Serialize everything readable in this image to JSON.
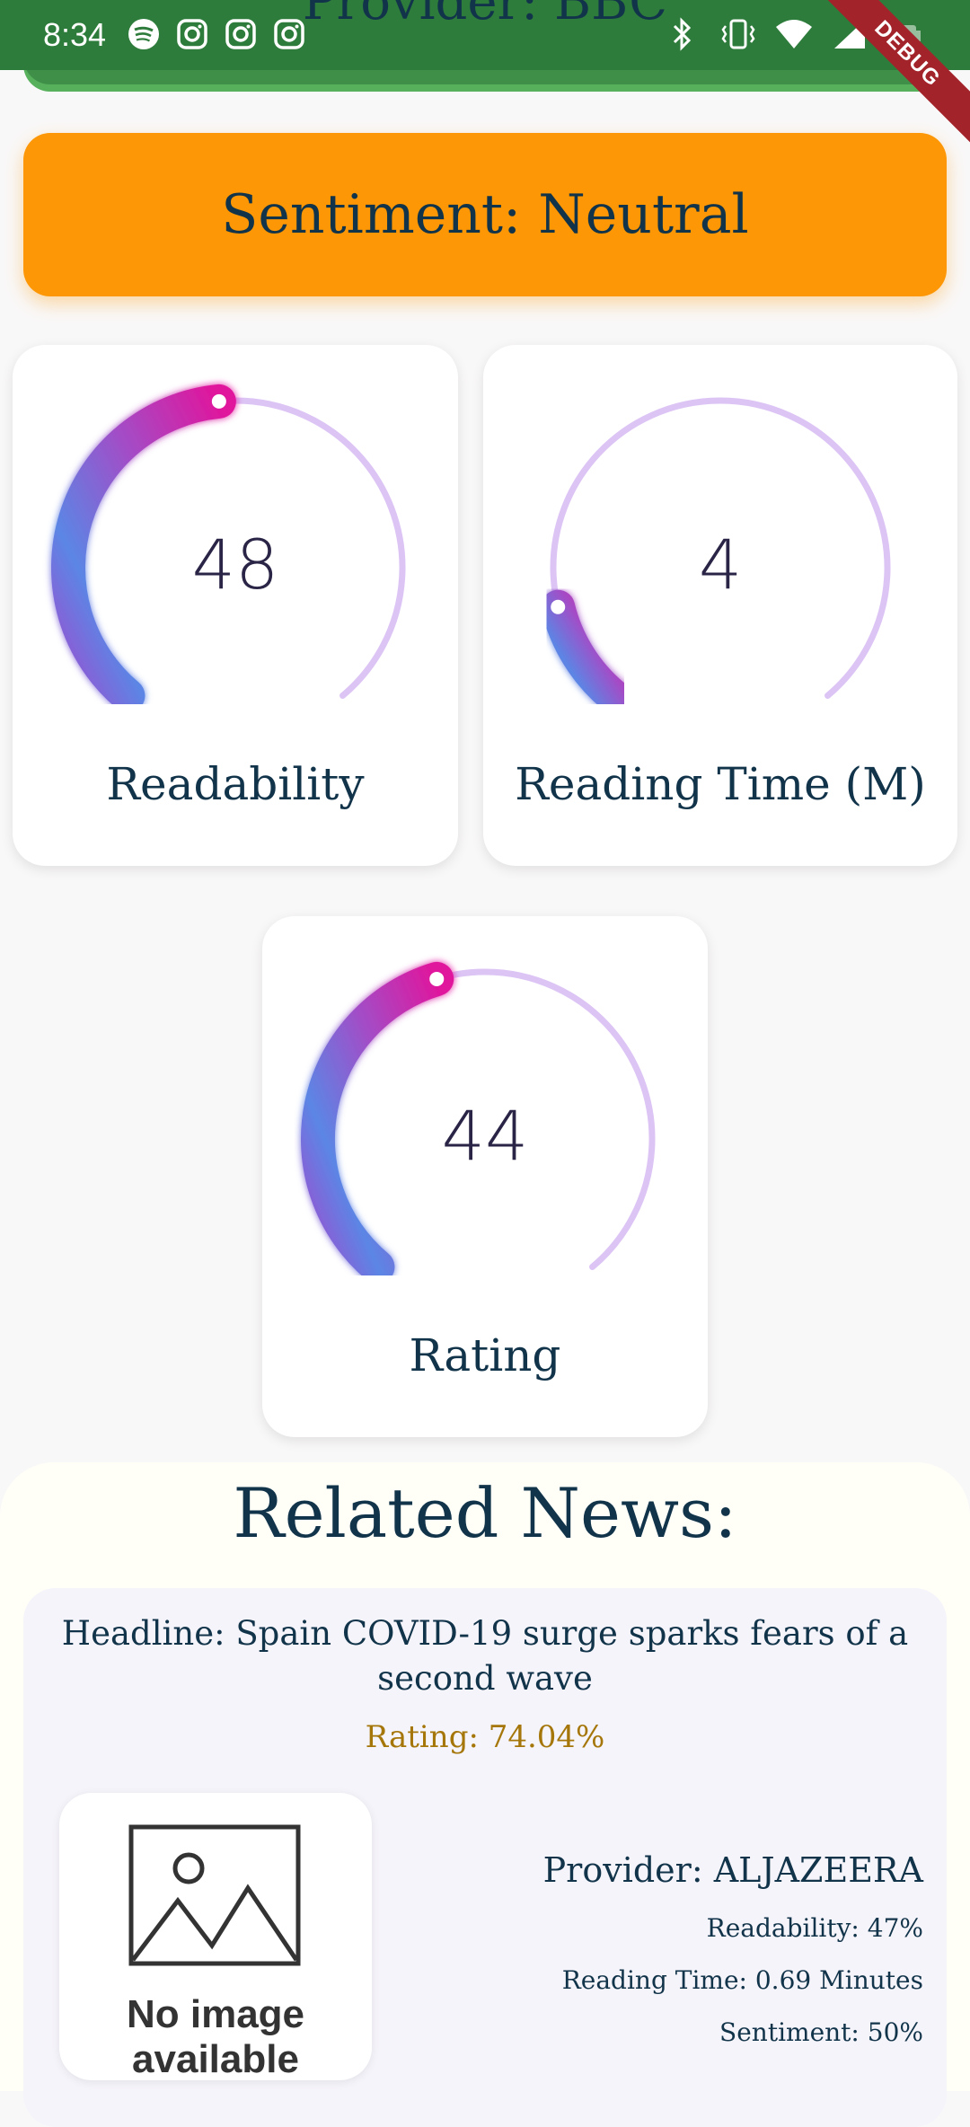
{
  "status_bar": {
    "time": "8:34",
    "left_icons": [
      "spotify-icon",
      "instagram-icon",
      "instagram-icon",
      "instagram-icon"
    ],
    "right_icons": [
      "bluetooth-icon",
      "vibrate-icon",
      "wifi-icon",
      "signal-icon",
      "battery-icon"
    ]
  },
  "debug_label": "DEBUG",
  "header": {
    "provider_text": "Provider: BBC"
  },
  "sentiment": {
    "text": "Sentiment: Neutral",
    "color": "#fd9705"
  },
  "gauges": {
    "readability": {
      "value": "48",
      "level": 0.48,
      "label": "Readability"
    },
    "reading_time": {
      "value": "4",
      "level": 0.13,
      "label": "Reading Time (M)"
    },
    "rating": {
      "value": "44",
      "level": 0.44,
      "label": "Rating"
    }
  },
  "related": {
    "title": "Related News:",
    "items": [
      {
        "headline": "Headline: Spain COVID-19 surge sparks fears of a second wave",
        "rating": "Rating: 74.04%",
        "image_placeholder": "No image available",
        "provider": "Provider: ALJAZEERA",
        "readability": "Readability: 47%",
        "reading_time": "Reading Time: 0.69 Minutes",
        "sentiment": "Sentiment: 50%"
      }
    ]
  },
  "colors": {
    "header_green": "#3f8f48",
    "gauge_track": "#dcc4f5",
    "gauge_pink": "#e0169d",
    "gauge_blue": "#5b86e5",
    "gauge_purple": "#9b4fd0",
    "rating_gold": "#a5760a"
  }
}
